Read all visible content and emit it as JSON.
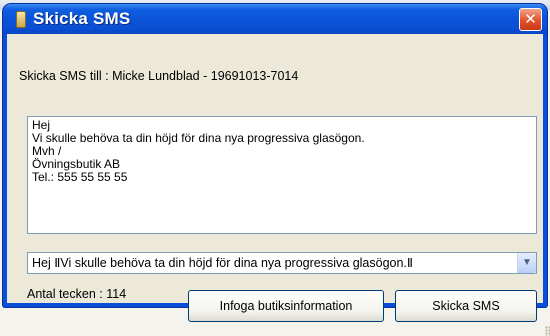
{
  "window": {
    "title": "Skicka SMS",
    "close_symbol": "✕"
  },
  "recipient_label": "Skicka SMS till : Micke Lundblad - 19691013-7014",
  "message": {
    "lines": [
      "Hej",
      "Vi skulle behöva ta din höjd för dina nya progressiva glasögon.",
      "Mvh /",
      "Övningsbutik AB",
      "Tel.: 555 55 55 55"
    ]
  },
  "template_select": {
    "value": "Hej ⅡVi skulle behöva ta din höjd för dina nya progressiva glasögon.Ⅱ",
    "arrow_icon": "chevron-down-icon"
  },
  "char_count_label": "Antal tecken : 114",
  "buttons": {
    "insert_label": "Infoga butiksinformation",
    "send_label": "Skicka SMS"
  },
  "colors": {
    "titlebar": "#0a53d9",
    "close_button": "#e2512a",
    "dialog_background": "#ece9d8"
  }
}
